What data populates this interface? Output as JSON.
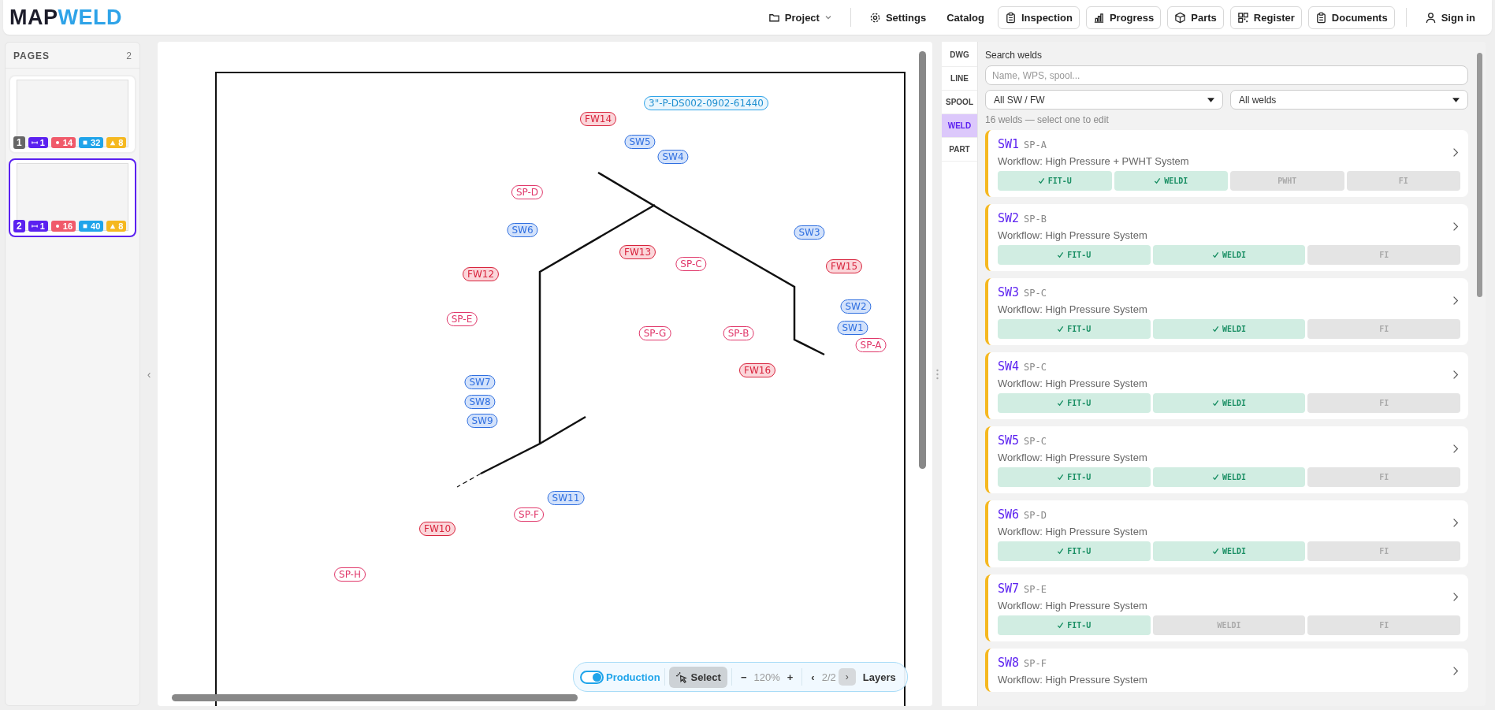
{
  "header": {
    "logo": {
      "part_1": "MAP",
      "part_2": "WELD"
    },
    "nav": [
      "Project",
      "Settings",
      "Catalog",
      "Inspection",
      "Progress",
      "Parts",
      "Register",
      "Documents",
      "Sign in"
    ]
  },
  "pages_panel": {
    "title": "PAGES",
    "count": "2",
    "collapse_handle": "‹",
    "pages": [
      {
        "number": "1",
        "selected": false,
        "badges": [
          {
            "kind": "line",
            "count": "1",
            "color": "#5b21f0"
          },
          {
            "kind": "dot",
            "count": "14",
            "color": "#f05a6a"
          },
          {
            "kind": "square",
            "count": "32",
            "color": "#1fa4ea"
          },
          {
            "kind": "triangle",
            "count": "8",
            "color": "#f5b820"
          }
        ]
      },
      {
        "number": "2",
        "selected": true,
        "badges": [
          {
            "kind": "line",
            "count": "1",
            "color": "#5b21f0"
          },
          {
            "kind": "dot",
            "count": "16",
            "color": "#f05a6a"
          },
          {
            "kind": "square",
            "count": "40",
            "color": "#1fa4ea"
          },
          {
            "kind": "triangle",
            "count": "8",
            "color": "#f5b820"
          }
        ]
      }
    ]
  },
  "viewer": {
    "markers": [
      {
        "kind": "line",
        "label": "3\"-P-DS002-0902-61440"
      },
      {
        "kind": "fw",
        "label": "FW14"
      },
      {
        "kind": "sw",
        "label": "SW5"
      },
      {
        "kind": "sw",
        "label": "SW4"
      },
      {
        "kind": "sp",
        "label": "SP-D"
      },
      {
        "kind": "sw",
        "label": "SW6"
      },
      {
        "kind": "fw",
        "label": "FW13"
      },
      {
        "kind": "sp",
        "label": "SP-C"
      },
      {
        "kind": "sw",
        "label": "SW3"
      },
      {
        "kind": "fw",
        "label": "FW15"
      },
      {
        "kind": "fw",
        "label": "FW12"
      },
      {
        "kind": "sp",
        "label": "SP-E"
      },
      {
        "kind": "sw",
        "label": "SW2"
      },
      {
        "kind": "sw",
        "label": "SW1"
      },
      {
        "kind": "sp",
        "label": "SP-A"
      },
      {
        "kind": "sp",
        "label": "SP-G"
      },
      {
        "kind": "sp",
        "label": "SP-B"
      },
      {
        "kind": "fw",
        "label": "FW16"
      },
      {
        "kind": "sw",
        "label": "SW7"
      },
      {
        "kind": "sw",
        "label": "SW8"
      },
      {
        "kind": "sw",
        "label": "SW9"
      },
      {
        "kind": "sw",
        "label": "SW11"
      },
      {
        "kind": "sp",
        "label": "SP-F"
      },
      {
        "kind": "fw",
        "label": "FW10"
      },
      {
        "kind": "sp",
        "label": "SP-H"
      }
    ],
    "toolbar": {
      "mode": {
        "label": "Production",
        "on": true
      },
      "select": {
        "label": "Select",
        "selected": true
      },
      "zoom_out": "−",
      "zoom": "120%",
      "zoom_in": "+",
      "prev": "‹",
      "page": "2/2",
      "next": {
        "label": "›",
        "disabled": true
      },
      "layers": "Layers"
    }
  },
  "side_panel": {
    "tabs": [
      {
        "label": "DWG",
        "selected": false
      },
      {
        "label": "LINE",
        "selected": false
      },
      {
        "label": "SPOOL",
        "selected": false
      },
      {
        "label": "WELD",
        "selected": true
      },
      {
        "label": "PART",
        "selected": false
      }
    ],
    "search": {
      "label": "Search welds",
      "placeholder": "Name, WPS, spool..."
    },
    "filters": [
      {
        "value": "All SW / FW"
      },
      {
        "value": "All welds"
      }
    ],
    "summary": "16 welds — select one to edit",
    "welds": [
      {
        "name": "SW1",
        "spool": "SP-A",
        "workflow": "Workflow: High Pressure + PWHT System",
        "steps": [
          {
            "label": "FIT-U",
            "done": true
          },
          {
            "label": "WELDI",
            "done": true
          },
          {
            "label": "PWHT",
            "done": false
          },
          {
            "label": "FI",
            "done": false
          }
        ]
      },
      {
        "name": "SW2",
        "spool": "SP-B",
        "workflow": "Workflow: High Pressure System",
        "steps": [
          {
            "label": "FIT-U",
            "done": true
          },
          {
            "label": "WELDI",
            "done": true
          },
          {
            "label": "FI",
            "done": false
          }
        ]
      },
      {
        "name": "SW3",
        "spool": "SP-C",
        "workflow": "Workflow: High Pressure System",
        "steps": [
          {
            "label": "FIT-U",
            "done": true
          },
          {
            "label": "WELDI",
            "done": true
          },
          {
            "label": "FI",
            "done": false
          }
        ]
      },
      {
        "name": "SW4",
        "spool": "SP-C",
        "workflow": "Workflow: High Pressure System",
        "steps": [
          {
            "label": "FIT-U",
            "done": true
          },
          {
            "label": "WELDI",
            "done": true
          },
          {
            "label": "FI",
            "done": false
          }
        ]
      },
      {
        "name": "SW5",
        "spool": "SP-C",
        "workflow": "Workflow: High Pressure System",
        "steps": [
          {
            "label": "FIT-U",
            "done": true
          },
          {
            "label": "WELDI",
            "done": true
          },
          {
            "label": "FI",
            "done": false
          }
        ]
      },
      {
        "name": "SW6",
        "spool": "SP-D",
        "workflow": "Workflow: High Pressure System",
        "steps": [
          {
            "label": "FIT-U",
            "done": true
          },
          {
            "label": "WELDI",
            "done": true
          },
          {
            "label": "FI",
            "done": false
          }
        ]
      },
      {
        "name": "SW7",
        "spool": "SP-E",
        "workflow": "Workflow: High Pressure System",
        "steps": [
          {
            "label": "FIT-U",
            "done": true
          },
          {
            "label": "WELDI",
            "done": false
          },
          {
            "label": "FI",
            "done": false
          }
        ]
      },
      {
        "name": "SW8",
        "spool": "SP-F",
        "workflow": "Workflow: High Pressure System"
      }
    ]
  }
}
